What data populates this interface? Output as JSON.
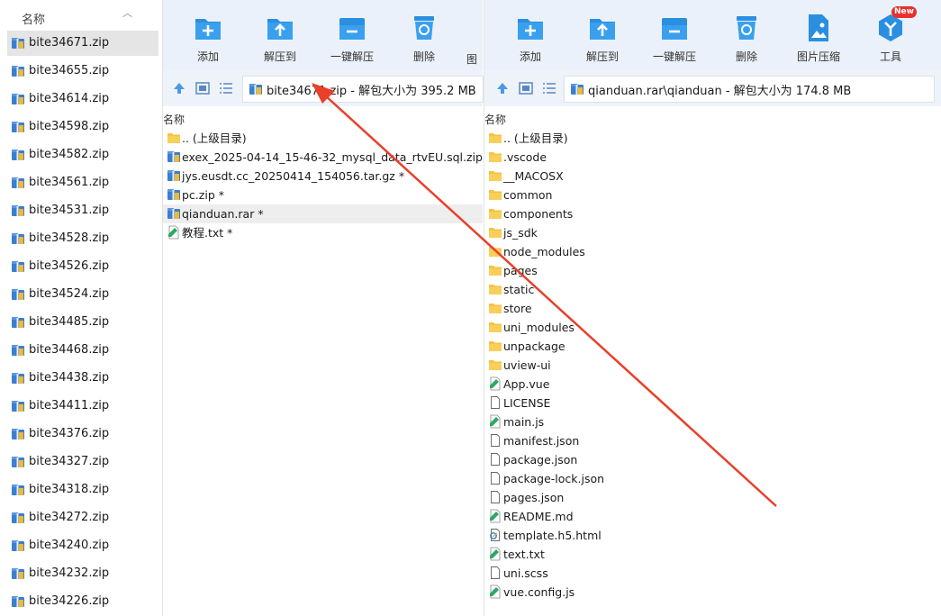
{
  "left_list": {
    "header": "名称",
    "items": [
      "bite34671.zip",
      "bite34655.zip",
      "bite34614.zip",
      "bite34598.zip",
      "bite34582.zip",
      "bite34561.zip",
      "bite34531.zip",
      "bite34528.zip",
      "bite34526.zip",
      "bite34524.zip",
      "bite34485.zip",
      "bite34468.zip",
      "bite34438.zip",
      "bite34411.zip",
      "bite34376.zip",
      "bite34327.zip",
      "bite34318.zip",
      "bite34272.zip",
      "bite34240.zip",
      "bite34232.zip",
      "bite34226.zip"
    ]
  },
  "pane1": {
    "toolbar": [
      "添加",
      "解压到",
      "一键解压",
      "删除",
      "图"
    ],
    "address": "bite34671.zip - 解包大小为 395.2 MB",
    "column": "名称",
    "files": [
      {
        "name": ".. (上级目录)",
        "icon": "folder-icon"
      },
      {
        "name": "exex_2025-04-14_15-46-32_mysql_data_rtvEU.sql.zip *",
        "icon": "zip-icon"
      },
      {
        "name": "jys.eusdt.cc_20250414_154056.tar.gz *",
        "icon": "zip-icon"
      },
      {
        "name": "pc.zip *",
        "icon": "zip-icon"
      },
      {
        "name": "qianduan.rar *",
        "icon": "zip-icon"
      },
      {
        "name": "教程.txt *",
        "icon": "text-file-icon"
      }
    ]
  },
  "pane2": {
    "toolbar": [
      "添加",
      "解压到",
      "一键解压",
      "删除",
      "图片压缩",
      "工具"
    ],
    "badge": "New",
    "address": "qianduan.rar\\qianduan - 解包大小为 174.8 MB",
    "column": "名称",
    "files": [
      {
        "name": ".. (上级目录)",
        "icon": "folder-icon"
      },
      {
        "name": ".vscode",
        "icon": "folder-icon"
      },
      {
        "name": "__MACOSX",
        "icon": "folder-icon"
      },
      {
        "name": "common",
        "icon": "folder-icon"
      },
      {
        "name": "components",
        "icon": "folder-icon"
      },
      {
        "name": "js_sdk",
        "icon": "folder-icon"
      },
      {
        "name": "node_modules",
        "icon": "folder-icon"
      },
      {
        "name": "pages",
        "icon": "folder-icon"
      },
      {
        "name": "static",
        "icon": "folder-icon"
      },
      {
        "name": "store",
        "icon": "folder-icon"
      },
      {
        "name": "uni_modules",
        "icon": "folder-icon"
      },
      {
        "name": "unpackage",
        "icon": "folder-icon"
      },
      {
        "name": "uview-ui",
        "icon": "folder-icon"
      },
      {
        "name": "App.vue",
        "icon": "green-file-icon"
      },
      {
        "name": "LICENSE",
        "icon": "blank-file-icon"
      },
      {
        "name": "main.js",
        "icon": "green-file-icon"
      },
      {
        "name": "manifest.json",
        "icon": "blank-file-icon"
      },
      {
        "name": "package.json",
        "icon": "blank-file-icon"
      },
      {
        "name": "package-lock.json",
        "icon": "blank-file-icon"
      },
      {
        "name": "pages.json",
        "icon": "blank-file-icon"
      },
      {
        "name": "README.md",
        "icon": "green-file-icon"
      },
      {
        "name": "template.h5.html",
        "icon": "html-file-icon"
      },
      {
        "name": "text.txt",
        "icon": "green-file-icon"
      },
      {
        "name": "uni.scss",
        "icon": "blank-file-icon"
      },
      {
        "name": "vue.config.js",
        "icon": "green-file-icon"
      }
    ]
  },
  "colors": {
    "accent": "#2a8fe0",
    "toolbar_bg": "#eaf1fa",
    "arrow": "#e8402a",
    "folder": "#f5c242"
  }
}
